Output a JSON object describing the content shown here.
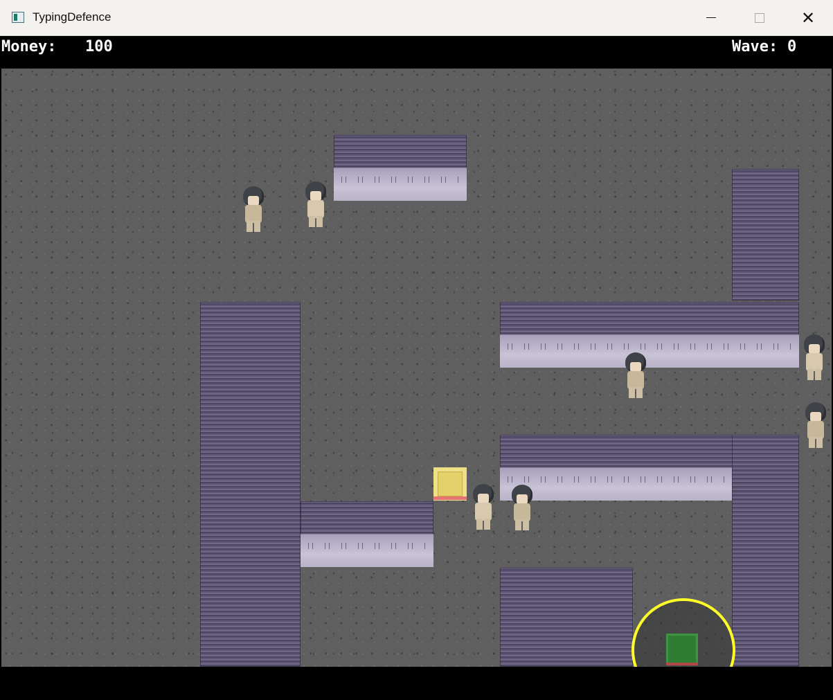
{
  "window": {
    "title": "TypingDefence",
    "icons": {
      "app": "app-window-icon",
      "minimize": "minimize-icon",
      "maximize": "maximize-icon",
      "close": "close-icon"
    },
    "close_glyph": "✕"
  },
  "hud": {
    "money_label": "Money:",
    "money_value": "100",
    "wave_label": "Wave:",
    "wave_value": "0"
  },
  "colors": {
    "ground": "#5f5f5f",
    "wall_top": "#5c5670",
    "wall_face": "#c9c3d6",
    "range_circle": "#ffff2a",
    "tower_yellow": "#e5d16a",
    "tower_green": "#2f7d32",
    "health_bar": "#e57474"
  },
  "sprites": {
    "enemy": "zombie-sprite",
    "tower_selected": "yellow-tower-tile",
    "tower_base": "green-tower-tile"
  }
}
